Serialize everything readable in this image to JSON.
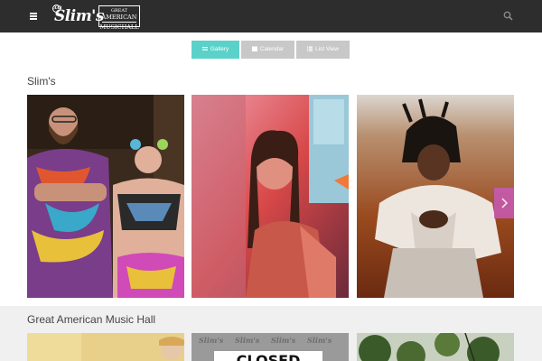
{
  "header": {
    "logo_slims": "Slim's",
    "logo_slims_ring": "333",
    "logo_gamh_line1": "GREAT",
    "logo_gamh_line2": "AMERICAN",
    "logo_gamh_line3": "MUSICHALL",
    "icons": [
      "menu-icon",
      "search-icon"
    ]
  },
  "views": {
    "gallery": "Gallery",
    "calendar": "Calendar",
    "list": "List View",
    "active": "gallery"
  },
  "sections": [
    {
      "title": "Slim's"
    },
    {
      "title": "Great American Music Hall"
    }
  ],
  "tile5_overlay_text": "CLOSED",
  "tile5_pattern_text": "Slim's",
  "colors": {
    "topbar": "#2d2d2d",
    "accent": "#5ad1c9",
    "inactive_toggle": "#c8c8c8",
    "arrow": "#c85ab7"
  }
}
